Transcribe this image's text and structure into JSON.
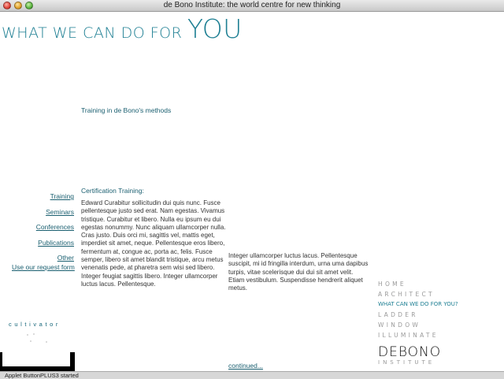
{
  "window": {
    "title": "de Bono Institute: the world centre for new thinking"
  },
  "page": {
    "title_small": "WHAT WE CAN DO FOR ",
    "title_big": "YOU",
    "intro": "Training in de Bono's methods",
    "cert_heading": "Certification Training:",
    "body_col1": "Edward Curabitur sollicitudin dui quis nunc. Fusce pellentesque justo sed erat. Nam egestas. Vivamus tristique. Curabitur et libero. Nulla eu ipsum eu dui egestas nonummy. Nunc aliquam ullamcorper nulla. Cras justo. Duis orci mi, sagittis vel, mattis eget, imperdiet sit amet, neque. Pellentesque eros libero, fermentum at, congue ac, porta ac, felis. Fusce semper, libero sit amet blandit tristique, arcu metus venenatis pede, at pharetra sem wisi sed libero. Integer feugiat sagittis libero. Integer ullamcorper luctus lacus. Pellentesque.",
    "body_col2": "Integer ullamcorper luctus lacus. Pellentesque suscipit, mi id fringilla interdum, urna uma dapibus turpis, vitae scelerisque dui dui sit amet velit. Etiam vestibulum. Suspendisse hendrerit aliquet metus.",
    "continued": "continued..."
  },
  "leftnav": {
    "items": [
      "Training",
      "Seminars",
      "Conferences",
      "Publications",
      "Other"
    ],
    "request": "Use our request form",
    "cultivator": "cultivator"
  },
  "rightnav": {
    "items": [
      "HOME",
      "ARCHITECT",
      "WHAT CAN WE DO FOR YOU?",
      "LADDER",
      "WINDOW",
      "ILLUMINATE"
    ],
    "active_index": 2
  },
  "logo": {
    "word": "DEBONO",
    "sub": "INSTITUTE"
  },
  "status": {
    "text": "Applet ButtonPLUS3 started"
  },
  "colors": {
    "accent": "#1e7f93",
    "link": "#1a5f70",
    "muted": "#9a9a9a"
  }
}
